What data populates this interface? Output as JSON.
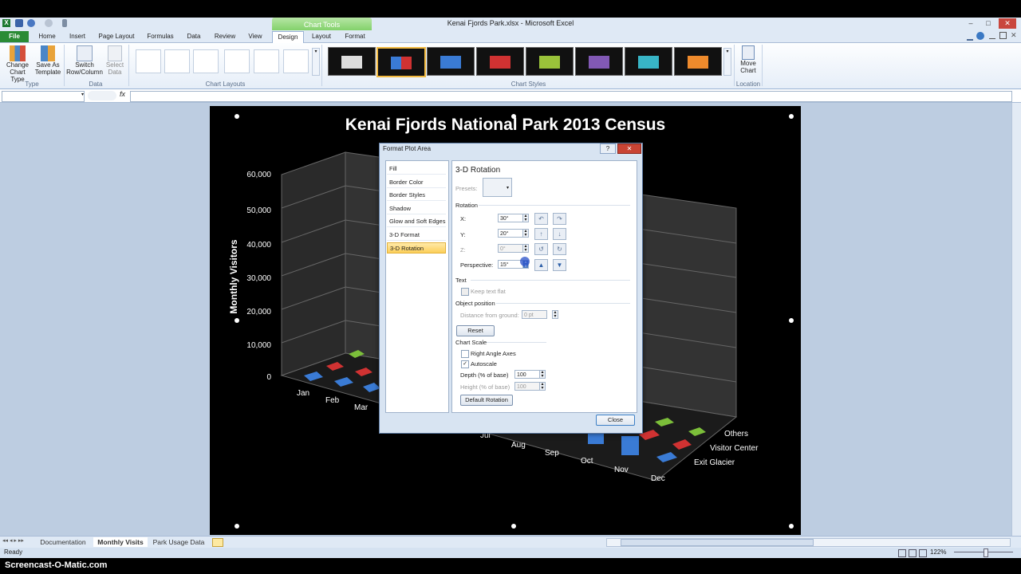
{
  "window": {
    "title": "Kenai Fjords Park.xlsx - Microsoft Excel",
    "min": "–",
    "max": "□",
    "close": "✕"
  },
  "ribbon": {
    "context_tab": "Chart Tools",
    "tabs": [
      "File",
      "Home",
      "Insert",
      "Page Layout",
      "Formulas",
      "Data",
      "Review",
      "View",
      "Design",
      "Layout",
      "Format"
    ],
    "change_chart_type": [
      "Change",
      "Chart Type"
    ],
    "save_as_template": [
      "Save As",
      "Template"
    ],
    "switch_row_column": [
      "Switch",
      "Row/Column"
    ],
    "select_data": [
      "Select",
      "Data"
    ],
    "move_chart": [
      "Move",
      "Chart"
    ],
    "groups": {
      "type": "Type",
      "data": "Data",
      "chart_layouts": "Chart Layouts",
      "chart_styles": "Chart Styles",
      "location": "Location"
    }
  },
  "formula_bar": {
    "fx": "fx"
  },
  "chart": {
    "title": "Kenai Fjords National Park 2013 Census",
    "y_axis_label": "Monthly Visitors",
    "y_ticks": [
      "60,000",
      "50,000",
      "40,000",
      "30,000",
      "20,000",
      "10,000",
      "0"
    ],
    "x_ticks": [
      "Jan",
      "Feb",
      "Mar",
      "Jul",
      "Aug",
      "Sep",
      "Oct",
      "Nov",
      "Dec"
    ],
    "z_ticks": [
      "Others",
      "Visitor Center",
      "Exit Glacier"
    ],
    "colors": {
      "exit_glacier": "#3a7bd5",
      "visitor_center": "#d03232",
      "others": "#7cbf3a"
    }
  },
  "dialog": {
    "title": "Format Plot Area",
    "help": "?",
    "close_x": "✕",
    "nav": [
      "Fill",
      "Border Color",
      "Border Styles",
      "Shadow",
      "Glow and Soft Edges",
      "3-D Format",
      "3-D Rotation"
    ],
    "selected_nav": "3-D Rotation",
    "heading": "3-D Rotation",
    "presets_label": "Presets:",
    "rotation_label": "Rotation",
    "x_label": "X:",
    "x_value": "30°",
    "y_label": "Y:",
    "y_value": "20°",
    "z_label": "Z:",
    "z_value": "0°",
    "perspective_label": "Perspective:",
    "perspective_value": "15°",
    "text_label": "Text",
    "keep_text_flat": "Keep text flat",
    "object_position_label": "Object position",
    "distance_label": "Distance from ground:",
    "distance_value": "0 pt",
    "reset_button": "Reset",
    "chart_scale_label": "Chart Scale",
    "right_angle_axes": "Right Angle Axes",
    "autoscale": "Autoscale",
    "depth_label": "Depth (% of base)",
    "depth_value": "100",
    "height_label": "Height (% of base)",
    "height_value": "100",
    "default_rotation_button": "Default Rotation",
    "close_button": "Close"
  },
  "sheets": {
    "tabs": [
      "Documentation",
      "Monthly Visits",
      "Park Usage Data"
    ],
    "active": "Monthly Visits"
  },
  "status": {
    "ready": "Ready",
    "zoom": "122%"
  },
  "watermark": "Screencast-O-Matic.com"
}
